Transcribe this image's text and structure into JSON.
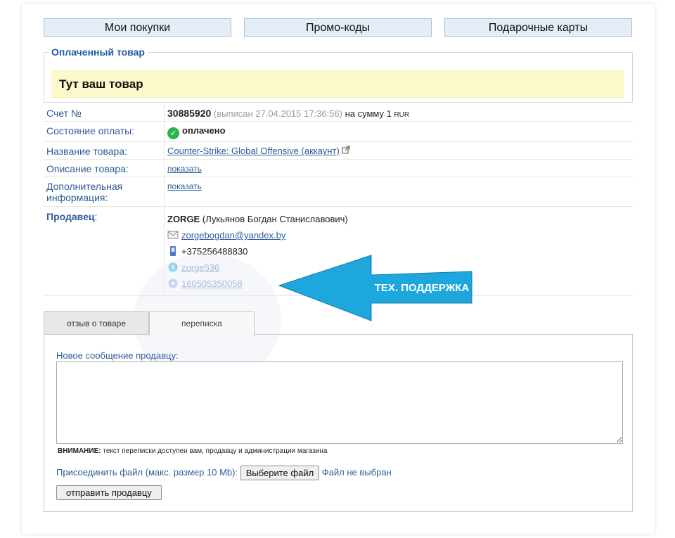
{
  "top_nav": {
    "my_purchases": "Мои покупки",
    "promo_codes": "Промо-коды",
    "gift_cards": "Подарочные карты"
  },
  "paid_item": {
    "legend": "Оплаченный товар",
    "content": "Тут ваш товар"
  },
  "info": {
    "invoice_label": "Счет №",
    "invoice_number": "30885920",
    "invoice_issued": "(выписан 27.04.2015 17:36:56)",
    "invoice_sum_prefix": "на сумму 1",
    "invoice_currency": "RUR",
    "payment_status_label": "Состояние оплаты:",
    "payment_status": "оплачено",
    "product_name_label": "Название товара:",
    "product_name": "Counter-Strike: Global Offensive (аккаунт)",
    "product_desc_label": "Описание товара:",
    "product_desc_link": "показать",
    "extra_info_label": "Дополнительная информация:",
    "extra_info_link": "показать",
    "seller_label": "Продавец",
    "seller_label_colon": ":",
    "seller_nick": "ZORGE",
    "seller_fullname": "(Лукьянов Богдан Станиславович)",
    "seller_email": "zorgebogdan@yandex.by",
    "seller_phone": "+375256488830",
    "seller_skype": "zorge536",
    "seller_icq": "160505350058"
  },
  "annotation": {
    "label": "ТЕХ. ПОДДЕРЖКА",
    "color": "#1ea7dd"
  },
  "tabs": {
    "review": "отзыв о товаре",
    "correspondence": "переписка"
  },
  "message": {
    "new_label": "Новое сообщение продавцу:",
    "textarea_value": "",
    "warning_bold": "ВНИМАНИЕ:",
    "warning_text": "текст переписки доступен вам, продавцу и администрации магазина",
    "attach_label": "Присоединить файл (макс. размер 10 Mb):",
    "choose_file": "Выберите файл",
    "no_file": "Файл не выбран",
    "send": "отправить продавцу"
  }
}
